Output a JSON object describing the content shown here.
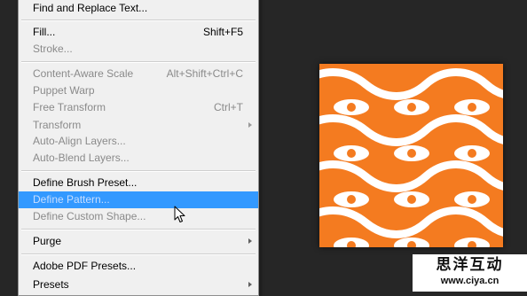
{
  "menu": {
    "items": [
      {
        "label": "Find and Replace Text...",
        "shortcut": "",
        "disabled": false
      },
      {
        "label": "Fill...",
        "shortcut": "Shift+F5",
        "disabled": false
      },
      {
        "label": "Stroke...",
        "shortcut": "",
        "disabled": true
      },
      {
        "label": "Content-Aware Scale",
        "shortcut": "Alt+Shift+Ctrl+C",
        "disabled": true
      },
      {
        "label": "Puppet Warp",
        "shortcut": "",
        "disabled": true
      },
      {
        "label": "Free Transform",
        "shortcut": "Ctrl+T",
        "disabled": true
      },
      {
        "label": "Transform",
        "shortcut": "",
        "disabled": true,
        "submenu": true
      },
      {
        "label": "Auto-Align Layers...",
        "shortcut": "",
        "disabled": true
      },
      {
        "label": "Auto-Blend Layers...",
        "shortcut": "",
        "disabled": true
      },
      {
        "label": "Define Brush Preset...",
        "shortcut": "",
        "disabled": false
      },
      {
        "label": "Define Pattern...",
        "shortcut": "",
        "disabled": false,
        "highlighted": true
      },
      {
        "label": "Define Custom Shape...",
        "shortcut": "",
        "disabled": true
      },
      {
        "label": "Purge",
        "shortcut": "",
        "disabled": false,
        "submenu": true
      },
      {
        "label": "Adobe PDF Presets...",
        "shortcut": "",
        "disabled": false
      },
      {
        "label": "Presets",
        "shortcut": "",
        "disabled": false,
        "submenu": true
      }
    ]
  },
  "pattern_preview": {
    "background_color": "#f47b20",
    "foreground_color": "#ffffff",
    "motif": "wavy lines with eyes"
  },
  "watermark": {
    "title": "思洋互动",
    "url": "www.ciya.cn"
  },
  "colors": {
    "canvas_background": "#262626",
    "menu_background": "#f0f0f0",
    "highlight": "#3399ff"
  }
}
